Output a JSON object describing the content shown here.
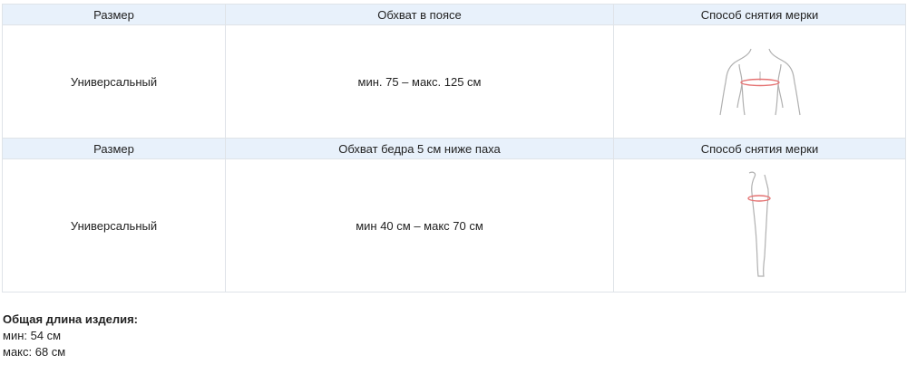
{
  "table1": {
    "header": {
      "size": "Размер",
      "measure": "Обхват в поясе",
      "method": "Способ снятия мерки"
    },
    "row": {
      "size": "Универсальный",
      "measure": "мин. 75 – макс. 125 см",
      "figure_icon": "waist-measurement-icon"
    }
  },
  "table2": {
    "header": {
      "size": "Размер",
      "measure": "Обхват бедра 5 см ниже паха",
      "method": "Способ снятия мерки"
    },
    "row": {
      "size": "Универсальный",
      "measure": "мин 40 см – макс 70 см",
      "figure_icon": "thigh-measurement-icon"
    }
  },
  "footer": {
    "heading": "Общая длина изделия:",
    "min": "мин: 54 см",
    "max": "макс: 68 см"
  },
  "colors": {
    "header_bg": "#e8f1fb",
    "border": "#dfe3e8",
    "measure_line": "#e57373",
    "figure_outline": "#b0b0b0"
  }
}
